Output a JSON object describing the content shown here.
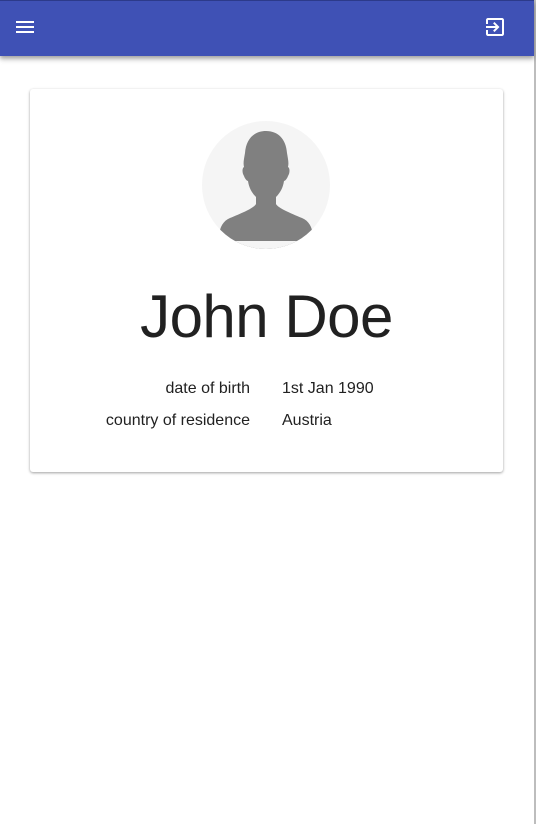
{
  "app_bar": {
    "menu_icon": "menu-icon",
    "logout_icon": "logout-icon",
    "color": "#3f51b5"
  },
  "profile": {
    "avatar_icon": "person-silhouette-icon",
    "name": "John Doe",
    "details": [
      {
        "label": "date of birth",
        "value": "1st Jan 1990"
      },
      {
        "label": "country of residence",
        "value": "Austria"
      }
    ]
  }
}
